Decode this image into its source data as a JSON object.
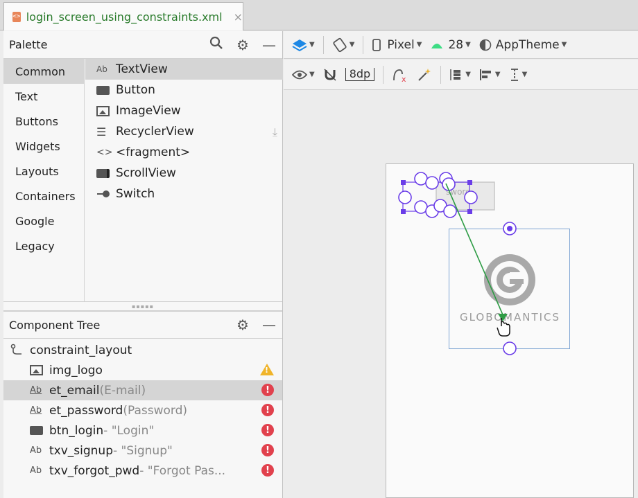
{
  "editor_tab": {
    "filename": "login_screen_using_constraints.xml",
    "close": "×",
    "file_icon": "<>"
  },
  "palette": {
    "title": "Palette",
    "categories": [
      "Common",
      "Text",
      "Buttons",
      "Widgets",
      "Layouts",
      "Containers",
      "Google",
      "Legacy"
    ],
    "selected_category": "Common",
    "items": [
      {
        "label": "TextView",
        "icon": "Ab"
      },
      {
        "label": "Button",
        "icon": "button-icon"
      },
      {
        "label": "ImageView",
        "icon": "image-icon"
      },
      {
        "label": "RecyclerView",
        "icon": "list-icon"
      },
      {
        "label": "<fragment>",
        "icon": "<>"
      },
      {
        "label": "ScrollView",
        "icon": "scrollview-icon"
      },
      {
        "label": "Switch",
        "icon": "switch-icon"
      }
    ]
  },
  "component_tree": {
    "title": "Component Tree",
    "root": "constraint_layout",
    "rows": [
      {
        "id": "img_logo",
        "sub": "",
        "icon": "image-icon",
        "status": "warning"
      },
      {
        "id": "et_email",
        "sub": "(E-mail)",
        "icon": "Ab",
        "status": "error"
      },
      {
        "id": "et_password",
        "sub": "(Password)",
        "icon": "Ab",
        "status": "error"
      },
      {
        "id": "btn_login",
        "sub": "- \"Login\"",
        "icon": "button-icon",
        "status": "error"
      },
      {
        "id": "txv_signup",
        "sub": "- \"Signup\"",
        "icon": "Ab",
        "status": "error"
      },
      {
        "id": "txv_forgot_pwd",
        "sub": "- \"Forgot Pas...",
        "icon": "Ab",
        "status": "error"
      }
    ]
  },
  "toolbar": {
    "device": "Pixel",
    "api": "28",
    "theme": "AppTheme",
    "margin": "8dp"
  },
  "canvas": {
    "logo_text": "GLOBOMANTICS",
    "overlapped_text": "sword",
    "colors": {
      "selection": "#6a3de8",
      "constraint_arrow": "#2e9c45",
      "logo_box": "#7da4d3"
    }
  }
}
